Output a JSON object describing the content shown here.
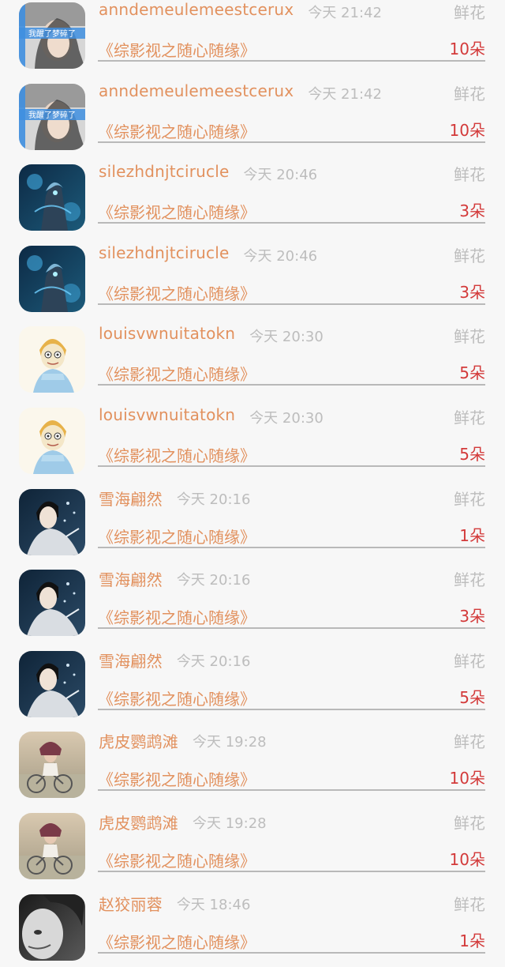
{
  "gift_label": "鲜花",
  "records": [
    {
      "user": "anndemeulemeestcerux",
      "time": "今天 21:42",
      "book": "《综影视之随心随缘》",
      "amount": "10朵",
      "avatar": "girl-photo-avatar"
    },
    {
      "user": "anndemeulemeestcerux",
      "time": "今天 21:42",
      "book": "《综影视之随心随缘》",
      "amount": "10朵",
      "avatar": "girl-photo-avatar"
    },
    {
      "user": "silezhdnjtcirucle",
      "time": "今天 20:46",
      "book": "《综影视之随心随缘》",
      "amount": "3朵",
      "avatar": "armored-warrior-avatar"
    },
    {
      "user": "silezhdnjtcirucle",
      "time": "今天 20:46",
      "book": "《综影视之随心随缘》",
      "amount": "3朵",
      "avatar": "armored-warrior-avatar"
    },
    {
      "user": "louisvwnuitatokn",
      "time": "今天 20:30",
      "book": "《综影视之随心随缘》",
      "amount": "5朵",
      "avatar": "cartoon-princess-avatar"
    },
    {
      "user": "louisvwnuitatokn",
      "time": "今天 20:30",
      "book": "《综影视之随心随缘》",
      "amount": "5朵",
      "avatar": "cartoon-princess-avatar"
    },
    {
      "user": "雪海翩然",
      "time": "今天 20:16",
      "book": "《综影视之随心随缘》",
      "amount": "1朵",
      "avatar": "costume-drama-avatar"
    },
    {
      "user": "雪海翩然",
      "time": "今天 20:16",
      "book": "《综影视之随心随缘》",
      "amount": "3朵",
      "avatar": "costume-drama-avatar"
    },
    {
      "user": "雪海翩然",
      "time": "今天 20:16",
      "book": "《综影视之随心随缘》",
      "amount": "5朵",
      "avatar": "costume-drama-avatar"
    },
    {
      "user": "虎皮鹦鹉滩",
      "time": "今天 19:28",
      "book": "《综影视之随心随缘》",
      "amount": "10朵",
      "avatar": "bicycle-couple-avatar"
    },
    {
      "user": "虎皮鹦鹉滩",
      "time": "今天 19:28",
      "book": "《综影视之随心随缘》",
      "amount": "10朵",
      "avatar": "bicycle-couple-avatar"
    },
    {
      "user": "赵狡丽蓉",
      "time": "今天 18:46",
      "book": "《综影视之随心随缘》",
      "amount": "1朵",
      "avatar": "bw-portrait-avatar"
    }
  ],
  "avatar_text": {
    "girl-photo-avatar": "我醒了梦碎了"
  }
}
